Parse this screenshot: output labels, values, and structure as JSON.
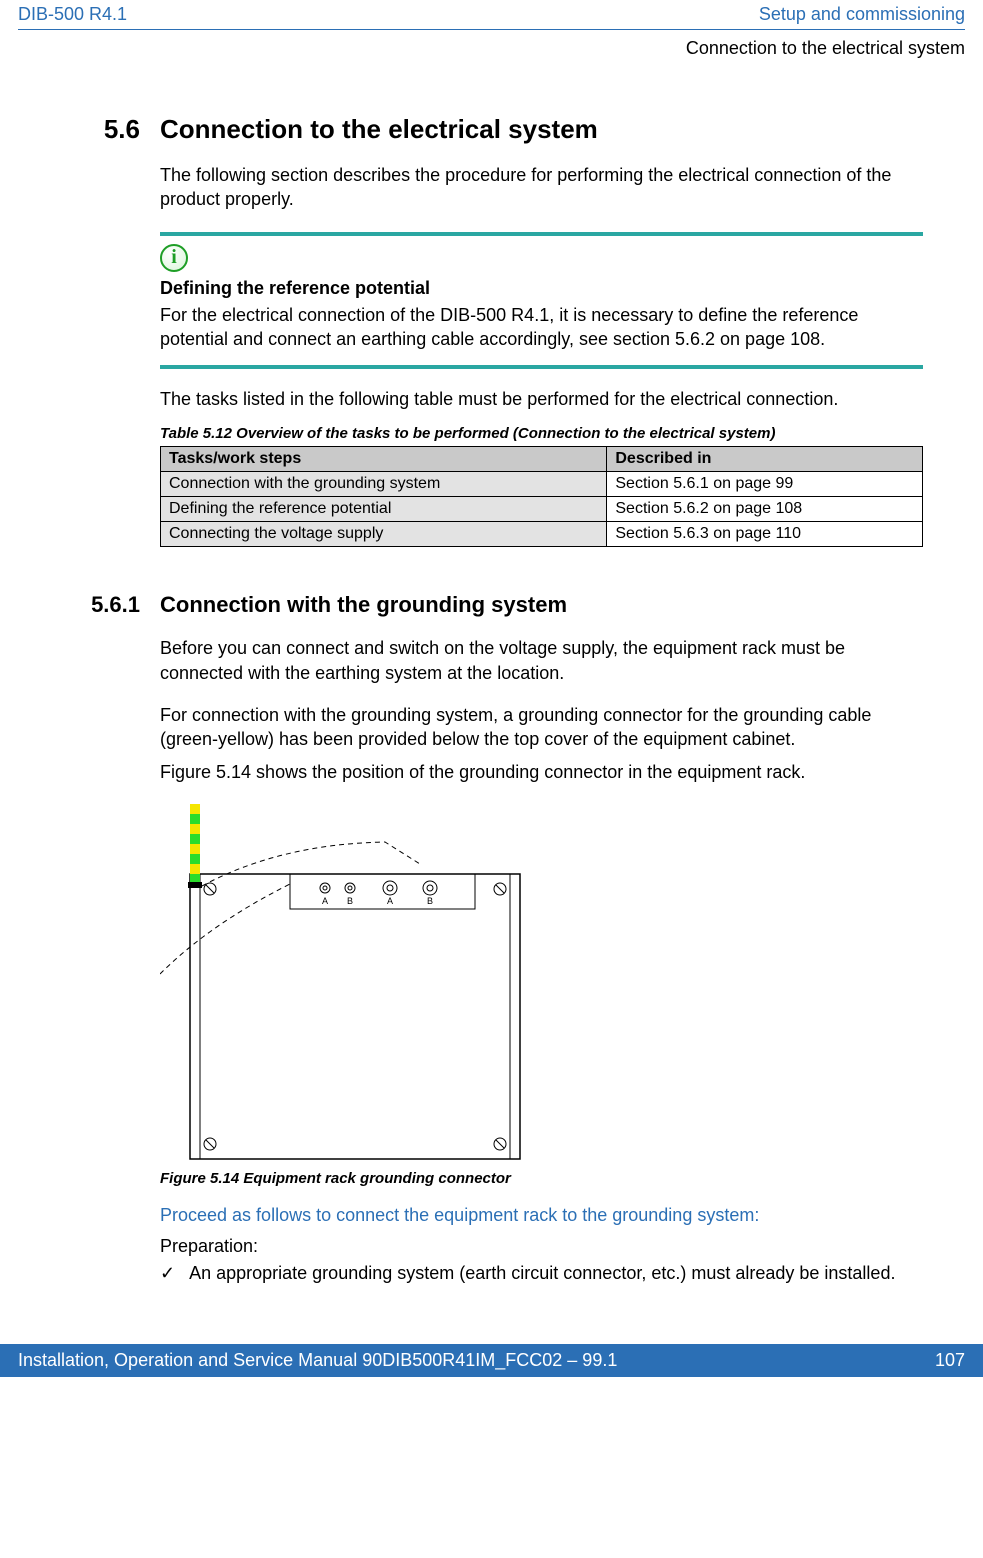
{
  "header": {
    "left": "DIB-500 R4.1",
    "right": "Setup and commissioning",
    "sub": "Connection to the electrical system"
  },
  "section": {
    "num": "5.6",
    "title": "Connection to the electrical system",
    "intro": "The following section describes the procedure for performing the electrical connection of the product properly."
  },
  "info_box": {
    "heading": "Defining the reference potential",
    "body": "For the electrical connection of the DIB-500 R4.1, it is necessary to define the reference potential and connect an earthing cable accordingly, see section 5.6.2 on page 108."
  },
  "tasks_intro": "The tasks listed in the following table must be performed for the electrical connection.",
  "table": {
    "caption": "Table 5.12   Overview of the tasks to be performed (Connection to the electrical system)",
    "headers": [
      "Tasks/work steps",
      "Described in"
    ],
    "rows": [
      [
        "Connection with the grounding system",
        "Section 5.6.1 on page 99"
      ],
      [
        "Defining the reference potential",
        "Section 5.6.2 on page 108"
      ],
      [
        "Connecting the voltage supply",
        "Section 5.6.3 on page 110"
      ]
    ]
  },
  "subsection": {
    "num": "5.6.1",
    "title": "Connection with the grounding system",
    "p1": "Before you can connect and switch on the voltage supply, the equipment rack must be connected with the earthing system at the location.",
    "p2": "For connection with the grounding system, a grounding connector for the grounding cable (green-yellow) has been provided below the top cover of the equipment cabinet.",
    "p3": "Figure 5.14 shows the position of the grounding connector in the equipment rack."
  },
  "figure": {
    "caption": "Figure 5.14 Equipment rack grounding connector",
    "labels": [
      "A",
      "B",
      "A",
      "B"
    ]
  },
  "instruction": "Proceed as follows to connect the equipment rack to the grounding system:",
  "preparation": {
    "label": "Preparation:",
    "item": "An appropriate grounding system (earth circuit connector, etc.) must already be installed."
  },
  "footer": {
    "left": "Installation, Operation and Service Manual 90DIB500R41IM_FCC02 – 99.1",
    "right": "107"
  }
}
